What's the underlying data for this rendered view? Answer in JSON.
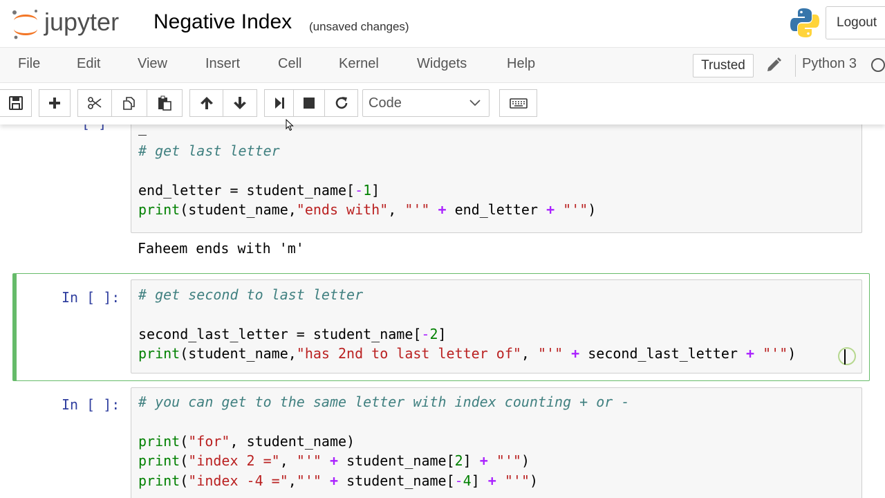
{
  "header": {
    "app_name": "jupyter",
    "notebook_name": "Negative Index",
    "save_status": "(unsaved changes)",
    "logout_label": "Logout"
  },
  "menubar": {
    "items": [
      "File",
      "Edit",
      "View",
      "Insert",
      "Cell",
      "Kernel",
      "Widgets",
      "Help"
    ],
    "trusted_label": "Trusted",
    "kernel_name": "Python 3"
  },
  "toolbar": {
    "cell_type": "Code",
    "icons": [
      "save-icon",
      "plus-icon",
      "scissors-icon",
      "copy-icon",
      "paste-icon",
      "arrow-up-icon",
      "arrow-down-icon",
      "run-icon",
      "stop-icon",
      "restart-icon",
      "keyboard-icon"
    ]
  },
  "cells": {
    "cell1": {
      "prompt_partial": "[ ]",
      "line_comment": "# get last letter",
      "line2": {
        "a": "end_letter = student_name[",
        "b": "-",
        "c": "1",
        "d": "]"
      },
      "line3": {
        "fn": "print",
        "a": "(student_name,",
        "s1": "\"ends with\"",
        "b": ", ",
        "s2": "\"'\"",
        "op1": "+",
        "c": " end_letter ",
        "op2": "+",
        "s3": "\"'\"",
        "d": ")"
      },
      "output": "Faheem ends with 'm'"
    },
    "cell2": {
      "prompt": "In [ ]:",
      "line_comment": "# get second to last letter",
      "line2": {
        "a": "second_last_letter = student_name[",
        "b": "-",
        "c": "2",
        "d": "]"
      },
      "line3": {
        "fn": "print",
        "a": "(student_name,",
        "s1": "\"has 2nd to last letter of\"",
        "b": ", ",
        "s2": "\"'\"",
        "op1": "+",
        "c": " second_last_letter ",
        "op2": "+",
        "s3": "\"'\"",
        "d": ")"
      }
    },
    "cell3": {
      "prompt": "In [ ]:",
      "line_comment": "# you can get to the same letter with index counting + or -",
      "line2": {
        "fn": "print",
        "a": "(",
        "s1": "\"for\"",
        "b": ", student_name)"
      },
      "line3": {
        "fn": "print",
        "a": "(",
        "s1": "\"index 2 =\"",
        "b": ", ",
        "s2": "\"'\"",
        "op1": "+",
        "c": " student_name[",
        "n": "2",
        "d": "] ",
        "op2": "+",
        "s3": "\"'\"",
        "e": ")"
      },
      "line4": {
        "fn": "print",
        "a": "(",
        "s1": "\"index -4 =\"",
        "b": ",",
        "s2": "\"'\"",
        "op1": "+",
        "c": " student_name[",
        "m": "-",
        "n": "4",
        "d": "] ",
        "op2": "+",
        "s3": "\"'\"",
        "e": ")"
      }
    }
  },
  "colors": {
    "selected_border": "#66bb6a",
    "prompt": "#303f9f",
    "comment": "#408080",
    "string": "#ba2121",
    "builtin": "#008000",
    "operator": "#aa22ff"
  }
}
